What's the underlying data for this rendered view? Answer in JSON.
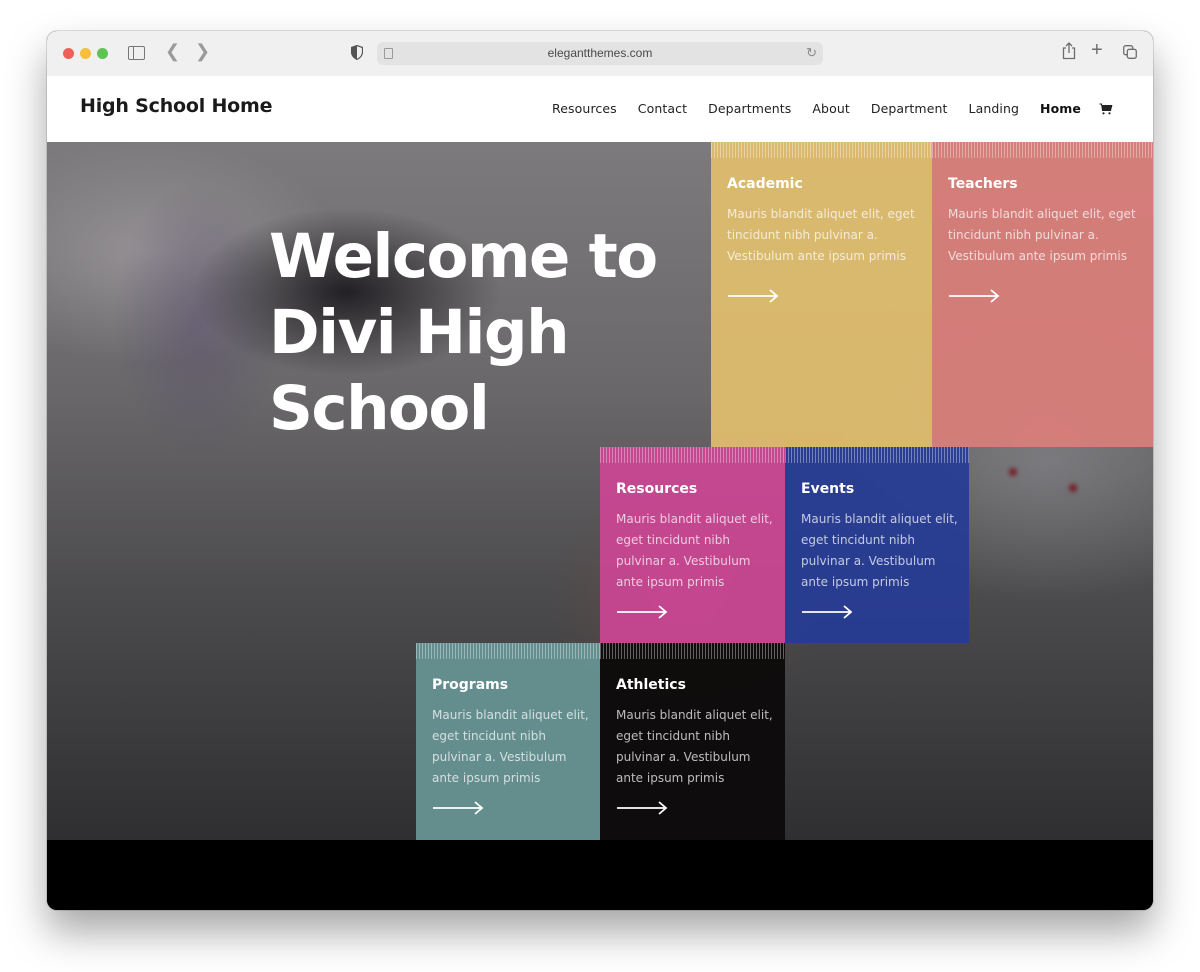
{
  "browser": {
    "url": "elegantthemes.com",
    "icons": [
      "sidebar-toggle-icon",
      "back-icon",
      "forward-icon",
      "privacy-shield-icon",
      "page-icon",
      "reload-icon",
      "share-icon",
      "new-tab-icon",
      "tabs-overview-icon"
    ]
  },
  "header": {
    "logo": "High School Home",
    "nav": [
      {
        "label": "Resources",
        "active": false
      },
      {
        "label": "Contact",
        "active": false
      },
      {
        "label": "Departments",
        "active": false
      },
      {
        "label": "About",
        "active": false
      },
      {
        "label": "Department",
        "active": false
      },
      {
        "label": "Landing",
        "active": false
      },
      {
        "label": "Home",
        "active": true
      }
    ],
    "cart_icon": "shopping-cart-icon"
  },
  "hero": {
    "title": "Welcome to Divi High School"
  },
  "cards": [
    {
      "title": "Academic",
      "text": "Mauris blandit aliquet elit, eget tincidunt nibh pulvinar a. Vestibulum ante ipsum primis",
      "color": "#e2bf6e"
    },
    {
      "title": "Teachers",
      "text": "Mauris blandit aliquet elit, eget tincidunt nibh pulvinar a. Vestibulum ante ipsum primis",
      "color": "#de7e7a"
    },
    {
      "title": "Resources",
      "text": "Mauris blandit aliquet elit, eget tincidunt nibh pulvinar a. Vestibulum ante ipsum primis",
      "color": "#ce4696"
    },
    {
      "title": "Events",
      "text": "Mauris blandit aliquet elit, eget tincidunt nibh pulvinar a. Vestibulum ante ipsum primis",
      "color": "#263c96"
    },
    {
      "title": "Programs",
      "text": "Mauris blandit aliquet elit, eget tincidunt nibh pulvinar a. Vestibulum ante ipsum primis",
      "color": "#669292"
    },
    {
      "title": "Athletics",
      "text": "Mauris blandit aliquet elit, eget tincidunt nibh pulvinar a. Vestibulum ante ipsum primis",
      "color": "#0c0a0a"
    }
  ]
}
